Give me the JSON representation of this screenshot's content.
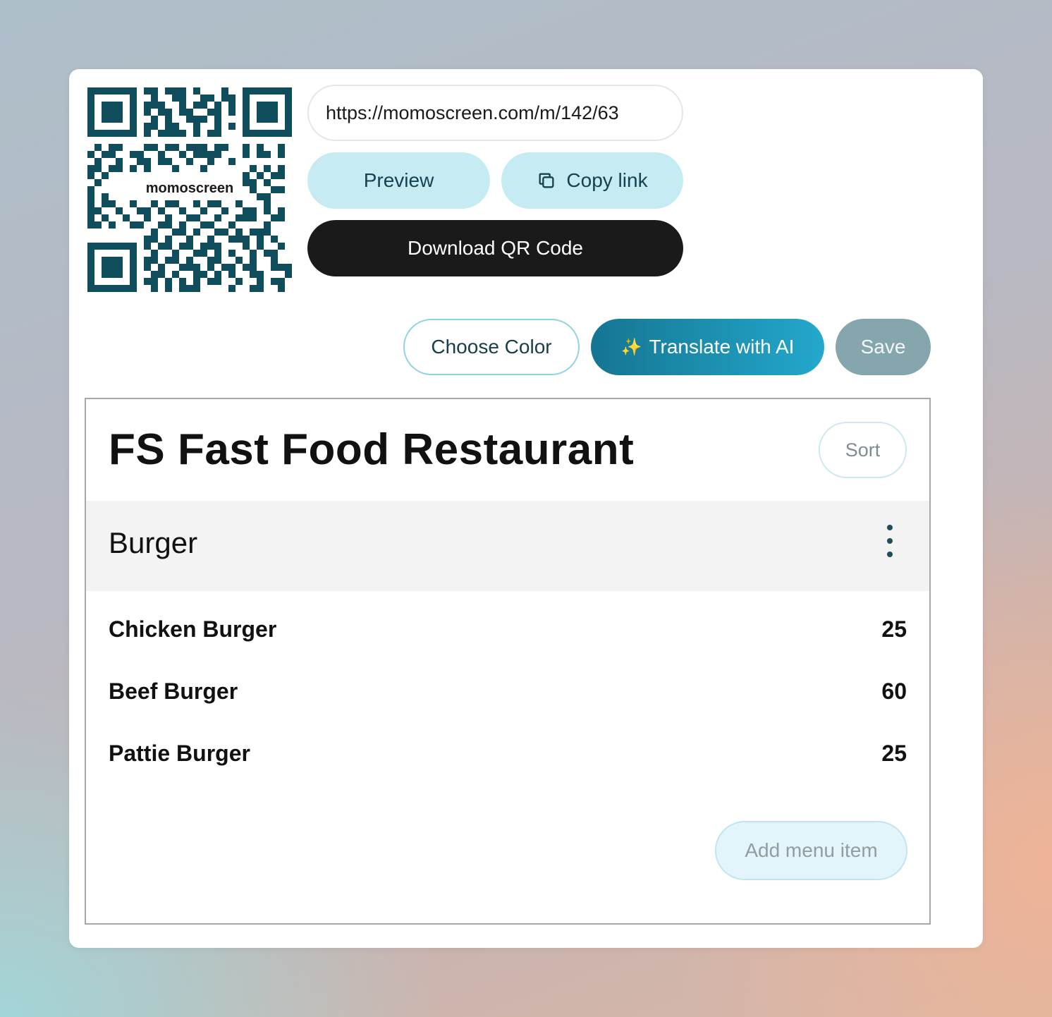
{
  "qr": {
    "label": "momoscreen",
    "color": "#0f4c5c"
  },
  "share": {
    "url": "https://momoscreen.com/m/142/63",
    "preview_label": "Preview",
    "copy_label": "Copy link",
    "copy_icon": "copy-icon",
    "download_label": "Download QR Code"
  },
  "toolbar": {
    "choose_color_label": "Choose Color",
    "translate_label": "Translate with AI",
    "translate_icon": "✨",
    "save_label": "Save"
  },
  "menu": {
    "title": "FS Fast Food Restaurant",
    "sort_label": "Sort",
    "categories": [
      {
        "name": "Burger",
        "items": [
          {
            "name": "Chicken Burger",
            "price": "25"
          },
          {
            "name": "Beef Burger",
            "price": "60"
          },
          {
            "name": "Pattie Burger",
            "price": "25"
          }
        ]
      }
    ],
    "add_item_label": "Add menu item"
  },
  "colors": {
    "accent_light": "#c7ebf3",
    "accent_dark": "#157592",
    "qr": "#0f4c5c",
    "save_disabled": "#86a6ae"
  }
}
